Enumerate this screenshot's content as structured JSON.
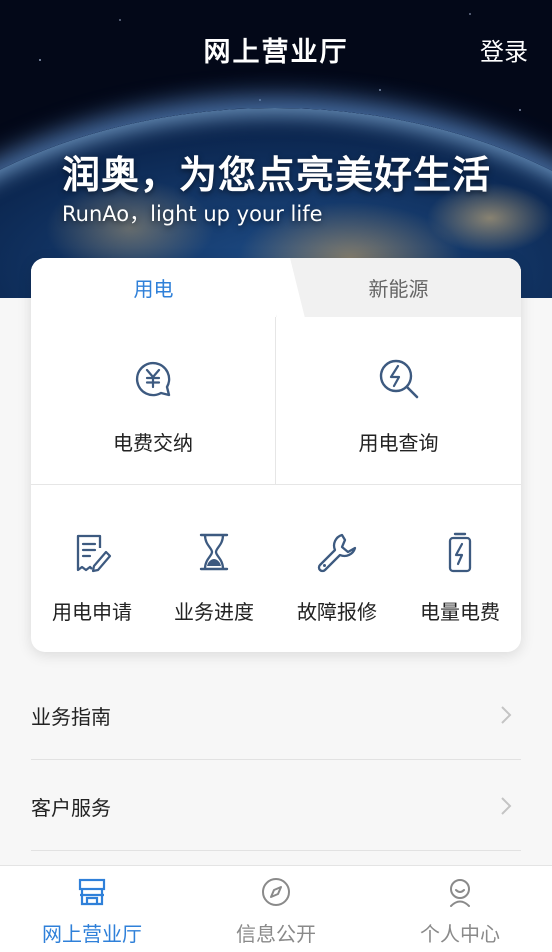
{
  "header": {
    "title": "网上营业厅",
    "login_label": "登录"
  },
  "hero": {
    "slogan": "润奥，为您点亮美好生活",
    "slogan_en": "RunAo，light up your life"
  },
  "tabs": [
    {
      "label": "用电",
      "active": true
    },
    {
      "label": "新能源",
      "active": false
    }
  ],
  "primary_services": [
    {
      "label": "电费交纳",
      "icon": "yuan-coin-icon"
    },
    {
      "label": "用电查询",
      "icon": "power-search-icon"
    }
  ],
  "secondary_services": [
    {
      "label": "用电申请",
      "icon": "form-edit-icon"
    },
    {
      "label": "业务进度",
      "icon": "hourglass-icon"
    },
    {
      "label": "故障报修",
      "icon": "wrench-icon"
    },
    {
      "label": "电量电费",
      "icon": "battery-icon"
    }
  ],
  "list": [
    {
      "label": "业务指南"
    },
    {
      "label": "客户服务"
    }
  ],
  "tabbar": [
    {
      "label": "网上营业厅",
      "icon": "store-icon",
      "active": true
    },
    {
      "label": "信息公开",
      "icon": "compass-icon",
      "active": false
    },
    {
      "label": "个人中心",
      "icon": "user-icon",
      "active": false
    }
  ],
  "colors": {
    "accent": "#2f80d9",
    "icon_stroke": "#3d5a80",
    "inactive": "#8a8a8a"
  }
}
